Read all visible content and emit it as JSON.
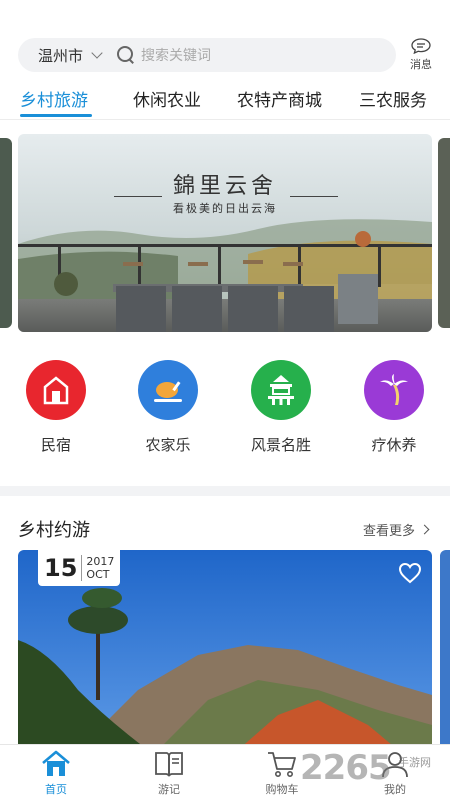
{
  "colors": {
    "accent": "#1a8fd8",
    "cat_minsu": "#e8262e",
    "cat_nongjiale": "#2f7fdc",
    "cat_fengjing": "#26b04c",
    "cat_liaoxiuyang": "#9a3ad6"
  },
  "header": {
    "city": "温州市",
    "search_placeholder": "搜索关键词",
    "message_label": "消息"
  },
  "tabs": [
    {
      "label": "乡村旅游",
      "active": true
    },
    {
      "label": "休闲农业",
      "active": false
    },
    {
      "label": "农特产商城",
      "active": false
    },
    {
      "label": "三农服务",
      "active": false
    }
  ],
  "banner": {
    "title": "錦里云舍",
    "subtitle": "看极美的日出云海"
  },
  "categories": [
    {
      "label": "民宿",
      "icon": "house-icon"
    },
    {
      "label": "农家乐",
      "icon": "roast-chicken-icon"
    },
    {
      "label": "风景名胜",
      "icon": "pagoda-icon"
    },
    {
      "label": "疗休养",
      "icon": "palm-tree-icon"
    }
  ],
  "section": {
    "title": "乡村约游",
    "see_more": "查看更多"
  },
  "trip_card": {
    "day": "15",
    "year": "2017",
    "month": "OCT"
  },
  "bottom_nav": [
    {
      "label": "首页",
      "icon": "home-icon",
      "active": true
    },
    {
      "label": "游记",
      "icon": "book-icon",
      "active": false
    },
    {
      "label": "购物车",
      "icon": "cart-icon",
      "active": false
    },
    {
      "label": "我的",
      "icon": "user-icon",
      "active": false
    }
  ],
  "watermark": {
    "brand": "2265",
    "site": "手游网"
  }
}
